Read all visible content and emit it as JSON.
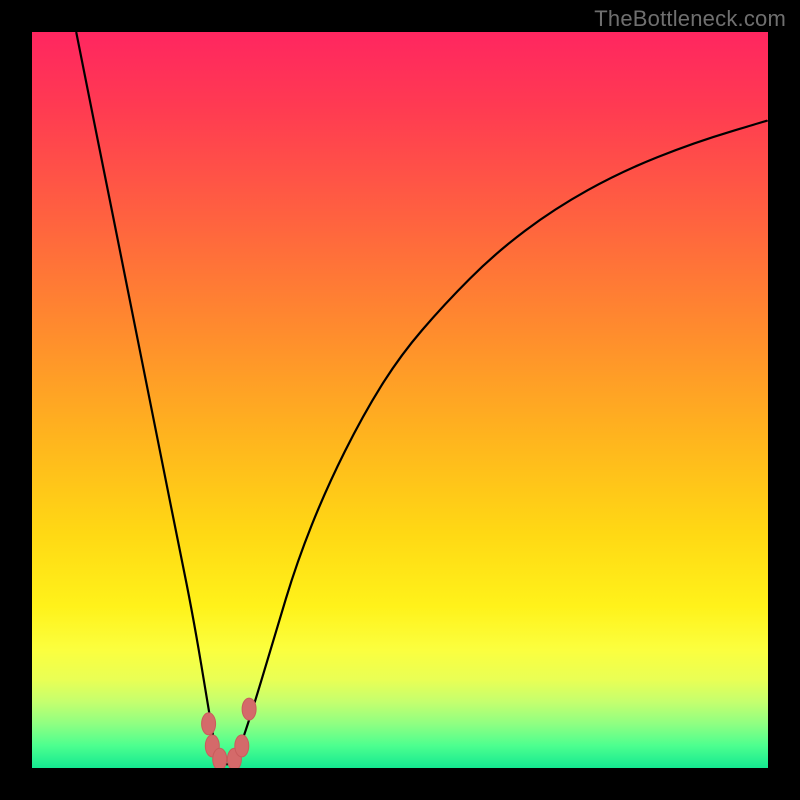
{
  "watermark": "TheBottleneck.com",
  "colors": {
    "gradient_top": "#ff2660",
    "gradient_mid": "#ffd814",
    "gradient_bottom": "#14e890",
    "curve": "#000000",
    "marker": "#d46a6a",
    "frame": "#000000"
  },
  "chart_data": {
    "type": "line",
    "title": "",
    "xlabel": "",
    "ylabel": "",
    "xlim": [
      0,
      100
    ],
    "ylim": [
      0,
      100
    ],
    "grid": false,
    "series": [
      {
        "name": "bottleneck-curve",
        "x": [
          6,
          8,
          10,
          12,
          14,
          16,
          18,
          20,
          22,
          24,
          25,
          26,
          27,
          28,
          30,
          33,
          36,
          40,
          45,
          50,
          56,
          63,
          71,
          80,
          90,
          100
        ],
        "y": [
          100,
          90,
          80,
          70,
          60,
          50,
          40,
          30,
          20,
          8,
          2,
          0.5,
          0.5,
          2,
          8,
          18,
          28,
          38,
          48,
          56,
          63,
          70,
          76,
          81,
          85,
          88
        ]
      }
    ],
    "markers": [
      {
        "x": 24.0,
        "y": 6.0
      },
      {
        "x": 24.5,
        "y": 3.0
      },
      {
        "x": 25.5,
        "y": 1.2
      },
      {
        "x": 27.5,
        "y": 1.2
      },
      {
        "x": 28.5,
        "y": 3.0
      },
      {
        "x": 29.5,
        "y": 8.0
      }
    ]
  }
}
